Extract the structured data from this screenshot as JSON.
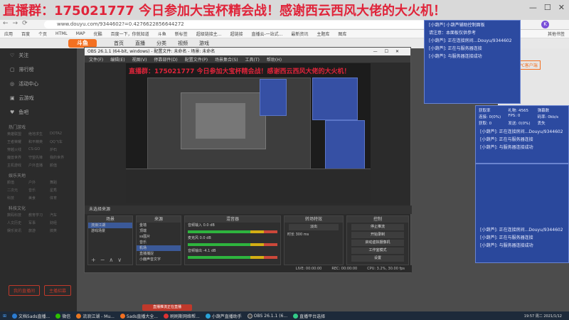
{
  "banner": {
    "title": "直播群：175021777 今日参加大宝杯精会战！感谢西云西风大佬的大火机！",
    "controls": [
      "—",
      "☐",
      "✕"
    ]
  },
  "browser": {
    "url": "www.douyu.com/9344602?=0.4276622856644272",
    "avatar_letter": "K",
    "nav_icons": [
      "←",
      "→",
      "⟳"
    ],
    "bookmarks": [
      "应用",
      "百度",
      "个页",
      "HTML",
      "MAP",
      "优酷",
      "百度一下，你就知道",
      "斗鱼",
      "新标签",
      "超级链接主...",
      "超链接",
      "直播云-一站式...",
      "最新资讯",
      "主题库",
      "图库"
    ],
    "bookmarks_right": "其他书签"
  },
  "site": {
    "logo": "斗鱼",
    "nav": [
      "首页",
      "直播",
      "分类",
      "视频",
      "游戏"
    ]
  },
  "sidebar": {
    "items": [
      {
        "icon": "♡",
        "label": "关注"
      },
      {
        "icon": "▢",
        "label": "排行榜"
      },
      {
        "icon": "◎",
        "label": "活动中心"
      },
      {
        "icon": "▣",
        "label": "云游戏"
      },
      {
        "icon": "♥",
        "label": "鱼吧"
      }
    ],
    "section1": "热门游戏",
    "grid1": [
      "英雄联盟",
      "绝地求生",
      "DOTA2",
      "王者荣耀",
      "和平精英",
      "QQ飞车",
      "穿越火线",
      "CS:GO",
      "炉石",
      "魔兽世界",
      "守望先锋",
      "我的世界",
      "主机游戏",
      "户外直播",
      "颜值"
    ],
    "section2": "娱乐天地",
    "grid2": [
      "颜值",
      "户外",
      "舞蹈",
      "二次元",
      "音乐",
      "星秀",
      "科技",
      "美食",
      "体育"
    ],
    "section3": "科技文化",
    "grid3": [
      "数码科技",
      "教育学习",
      "汽车",
      "人文历史",
      "军事",
      "财经",
      "娱乐资讯",
      "旅游",
      "搞笑"
    ],
    "live_buttons": [
      "我的直播间",
      "主播招募"
    ]
  },
  "right_strip": {
    "badge": "PC客户端"
  },
  "obs": {
    "title": "OBS 26.1.1 (64-bit, windows) - 配置文件: 未命名 - 场景: 未命名",
    "menu": [
      "文件(F)",
      "编辑(E)",
      "视图(V)",
      "停靠部件(D)",
      "配置文件(P)",
      "场景集合(S)",
      "工具(T)",
      "帮助(H)"
    ],
    "preview_text": "直播群：175021777 今日参加大宝杯精会战！感谢西云西风大佬的大火机！",
    "scene_bar": "未选择来源",
    "docks": {
      "scenes": {
        "title": "场景",
        "items": [
          "流浪江湖",
          "游戏场景"
        ]
      },
      "sources": {
        "title": "来源",
        "items": [
          "金墙",
          "顶端",
          "ss图片",
          "音乐",
          "机场",
          "直播捕捉",
          "小鹿声音文字"
        ]
      },
      "mixer": {
        "title": "混音器",
        "channels": [
          {
            "name": "音频输入",
            "db": "0.0 dB"
          },
          {
            "name": "麦克风",
            "db": "0.0 dB"
          },
          {
            "name": "音频输出",
            "db": "-4.1 dB"
          }
        ]
      },
      "transitions": {
        "title": "转场特效",
        "mode": "淡出",
        "duration_label": "时长",
        "duration": "300 ms"
      },
      "controls": {
        "title": "控制",
        "buttons": [
          "停止推流",
          "开始录制",
          "启动虚拟摄像机",
          "工作室模式",
          "设置",
          "退出"
        ]
      }
    },
    "status": {
      "live": "LIVE: 00:00:00",
      "rec": "REC: 00:00:00",
      "cpu": "CPU: 3.2%, 30.00 fps"
    }
  },
  "chat_a": {
    "lines": [
      "[小葫芦] 小葫芦辅助控制面板",
      "请注意：本面板仅供参考",
      "[小葫芦]: 正在连接房间...Douyu/9344602",
      "[小葫芦]: 正在与服务器连接",
      "[小葫芦]: 与服务器连接成功"
    ]
  },
  "chat_b": {
    "stats": [
      {
        "label": "获取率",
        "value": ""
      },
      {
        "label": "礼物",
        "value": "4565"
      },
      {
        "label": "弹幕数",
        "value": ""
      },
      {
        "label": "连接",
        "value": "0(0%)"
      },
      {
        "label": "FPS",
        "value": "0"
      },
      {
        "label": "码率",
        "value": "0kb/s"
      },
      {
        "label": "获取",
        "value": "0"
      },
      {
        "label": "发送",
        "value": "0(0%)"
      },
      {
        "label": "丢失",
        "value": ""
      }
    ],
    "lines": [
      "[小葫芦]: 正在连接房间...Douyu/9344602",
      "[小葫芦]: 正在与服务器连接",
      "[小葫芦]: 与服务器连接成功"
    ]
  },
  "chat_c": {
    "lines": [
      "[小葫芦]: 正在连接房间...Douyu/9344602",
      "[小葫芦]: 正在与服务器连接",
      "[小葫芦]: 与服务器连接成功"
    ]
  },
  "red_button": "直播推流正在直播",
  "taskbar": {
    "apps": [
      {
        "label": "文档5ads直播...",
        "color": "#2b7cd3"
      },
      {
        "label": "微信",
        "color": "#2dc100"
      },
      {
        "label": "流浪江湖 - Mu...",
        "color": "#e87722"
      },
      {
        "label": "5ads直播大全...",
        "color": "#f37021"
      },
      {
        "label": "刷刷斯网络帮...",
        "color": "#d33"
      },
      {
        "label": "小葫芦直播助手",
        "color": "#29a3d8"
      },
      {
        "label": "OBS 26.1.1 (6...",
        "color": "#444"
      },
      {
        "label": "直播平台选择",
        "color": "#3c8"
      }
    ],
    "clock": "19:57 周二 2021/1/12"
  }
}
